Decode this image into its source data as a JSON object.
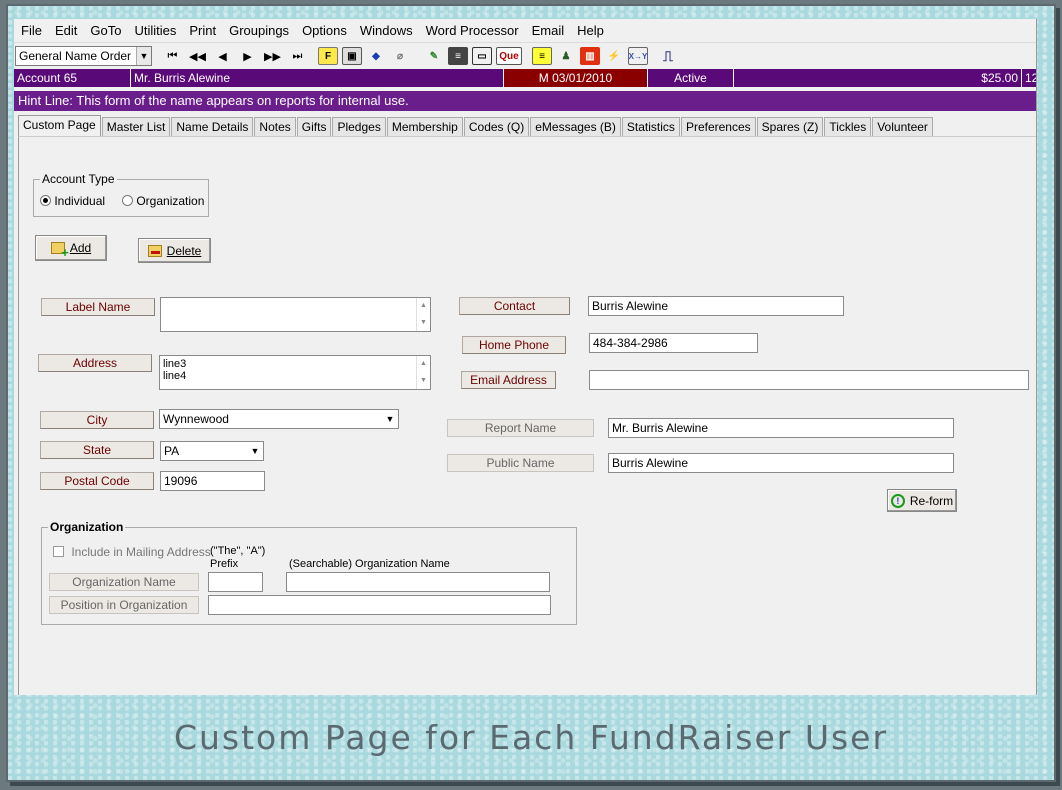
{
  "menu": [
    "File",
    "Edit",
    "GoTo",
    "Utilities",
    "Print",
    "Groupings",
    "Options",
    "Windows",
    "Word Processor",
    "Email",
    "Help"
  ],
  "toolbar": {
    "name_order": "General Name Order",
    "que_label": "Que"
  },
  "info": {
    "account": "Account 65",
    "name": "Mr. Burris Alewine",
    "date": "M 03/01/2010",
    "status": "Active",
    "amount": "$25.00",
    "extra": "12"
  },
  "hint": "Hint Line:  This form of the name appears on reports for internal use.",
  "tabs": [
    "Custom Page",
    "Master List",
    "Name Details",
    "Notes",
    "Gifts",
    "Pledges",
    "Membership",
    "Codes (Q)",
    "eMessages (B)",
    "Statistics",
    "Preferences",
    "Spares (Z)",
    "Tickles",
    "Volunteer"
  ],
  "account_type": {
    "legend": "Account Type",
    "individual": "Individual",
    "organization": "Organization",
    "selected": "Individual"
  },
  "buttons": {
    "add": "Add",
    "delete": "Delete",
    "reform": "Re-form"
  },
  "fields": {
    "label_name": {
      "label": "Label Name",
      "value": ""
    },
    "address": {
      "label": "Address",
      "line1": "line3",
      "line2": "line4"
    },
    "city": {
      "label": "City",
      "value": "Wynnewood"
    },
    "state": {
      "label": "State",
      "value": "PA"
    },
    "postal_code": {
      "label": "Postal Code",
      "value": "19096"
    },
    "contact": {
      "label": "Contact",
      "value": "Burris Alewine"
    },
    "home_phone": {
      "label": "Home Phone",
      "value": "484-384-2986"
    },
    "email": {
      "label": "Email Address",
      "value": ""
    },
    "report_name": {
      "label": "Report Name",
      "value": "Mr. Burris Alewine"
    },
    "public_name": {
      "label": "Public Name",
      "value": "Burris Alewine"
    }
  },
  "organization": {
    "legend": "Organization",
    "include_mailing": "Include in Mailing Address",
    "prefix_hint": "(\"The\", \"A\")",
    "prefix_label": "Prefix",
    "searchable_label": "(Searchable) Organization Name",
    "org_name_label": "Organization Name",
    "position_label": "Position in Organization",
    "prefix_value": "",
    "org_name_value": "",
    "position_value": ""
  },
  "caption": "Custom Page for Each FundRaiser User"
}
